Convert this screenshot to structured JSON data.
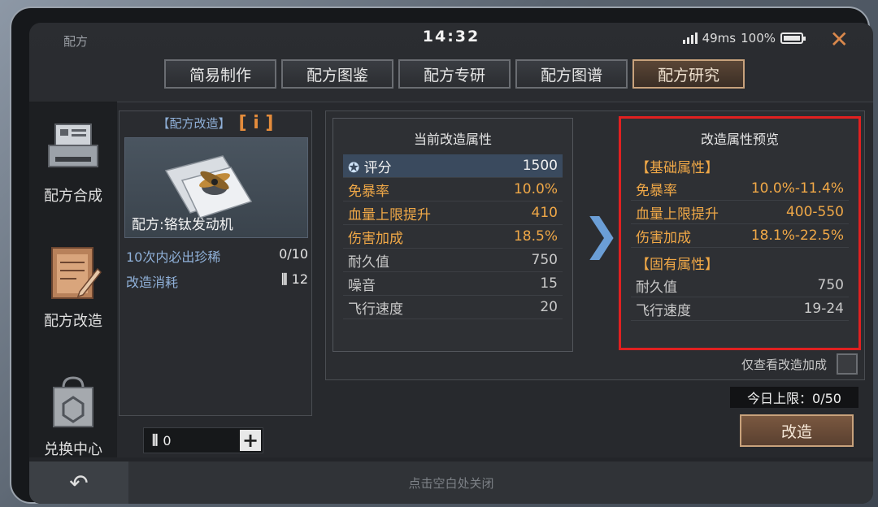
{
  "window": {
    "title": "配方",
    "clock": "14:32",
    "ping": "49ms",
    "battery": "100%"
  },
  "tabs": [
    {
      "label": "简易制作",
      "active": false
    },
    {
      "label": "配方图鉴",
      "active": false
    },
    {
      "label": "配方专研",
      "active": false
    },
    {
      "label": "配方图谱",
      "active": false
    },
    {
      "label": "配方研究",
      "active": true
    }
  ],
  "sidebar": {
    "items": [
      {
        "label": "配方合成",
        "icon": "printer-icon"
      },
      {
        "label": "配方改造",
        "icon": "notepad-pencil-icon"
      },
      {
        "label": "兑换中心",
        "icon": "shopping-bag-icon"
      }
    ]
  },
  "card": {
    "header": "【配方改造】",
    "item_name": "配方:铬钛发动机",
    "guarantee_label": "10次内必出珍稀",
    "guarantee_value": "0/10",
    "cost_label": "改造消耗",
    "cost_value": "12",
    "counter_value": "0"
  },
  "current": {
    "title": "当前改造属性",
    "rows": [
      {
        "label": "评分",
        "value": "1500"
      },
      {
        "label": "免暴率",
        "value": "10.0%"
      },
      {
        "label": "血量上限提升",
        "value": "410"
      },
      {
        "label": "伤害加成",
        "value": "18.5%"
      },
      {
        "label": "耐久值",
        "value": "750"
      },
      {
        "label": "噪音",
        "value": "15"
      },
      {
        "label": "飞行速度",
        "value": "20"
      }
    ]
  },
  "preview": {
    "title": "改造属性预览",
    "base_tag": "【基础属性】",
    "base_rows": [
      {
        "label": "免暴率",
        "value": "10.0%-11.4%"
      },
      {
        "label": "血量上限提升",
        "value": "400-550"
      },
      {
        "label": "伤害加成",
        "value": "18.1%-22.5%"
      }
    ],
    "fixed_tag": "【固有属性】",
    "fixed_rows": [
      {
        "label": "耐久值",
        "value": "750"
      },
      {
        "label": "飞行速度",
        "value": "19-24"
      }
    ]
  },
  "filter": {
    "label": "仅查看改造加成"
  },
  "daily_limit": "今日上限：0/50",
  "action": {
    "modify_label": "改造"
  },
  "footer": {
    "hint": "点击空白处关闭"
  },
  "colors": {
    "accent_orange": "#f0a847",
    "link_blue": "#8fb0d8",
    "highlight_red": "#e02020"
  }
}
